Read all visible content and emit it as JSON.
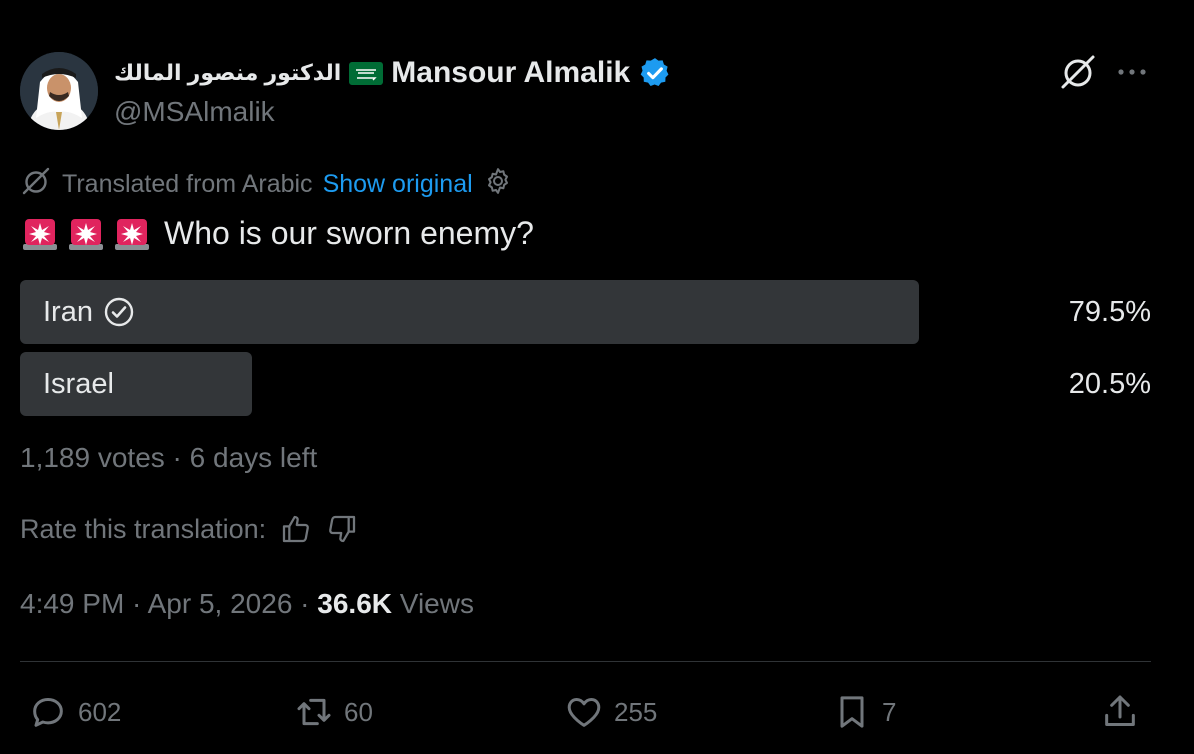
{
  "author": {
    "arabic_name": "الدكتور منصور المالك",
    "display_name": "Mansour Almalik",
    "handle": "@MSAlmalik",
    "icons": [
      "saudi-flag-icon",
      "verified-badge-icon",
      "grok-icon",
      "more-icon"
    ]
  },
  "translation": {
    "label": "Translated from Arabic",
    "show_original": "Show original",
    "icons": [
      "translate-icon",
      "gear-icon"
    ]
  },
  "tweet": {
    "emoji_icons": [
      "siren-icon",
      "siren-icon",
      "siren-icon"
    ],
    "text": "Who is our sworn enemy?"
  },
  "poll": {
    "options": [
      {
        "label": "Iran",
        "percent_text": "79.5%",
        "percent": 79.5,
        "selected": true
      },
      {
        "label": "Israel",
        "percent_text": "20.5%",
        "percent": 20.5,
        "selected": false
      }
    ],
    "meta": "1,189 votes · 6 days left"
  },
  "rate": {
    "label": "Rate this translation:",
    "icons": [
      "thumbs-up-icon",
      "thumbs-down-icon"
    ]
  },
  "timestamp": {
    "time_date": "4:49 PM · Apr 5, 2026 · ",
    "views_count": "36.6K",
    "views_label": " Views"
  },
  "actions": {
    "reply_count": "602",
    "repost_count": "60",
    "like_count": "255",
    "bookmark_count": "7"
  },
  "colors": {
    "background": "#000000",
    "text": "#e7e9ea",
    "muted": "#71767b",
    "link": "#1d9bf0",
    "poll_bar": "#333639",
    "verified": "#1d9bf0",
    "flag": "#006c35",
    "siren": "#e0245e"
  }
}
